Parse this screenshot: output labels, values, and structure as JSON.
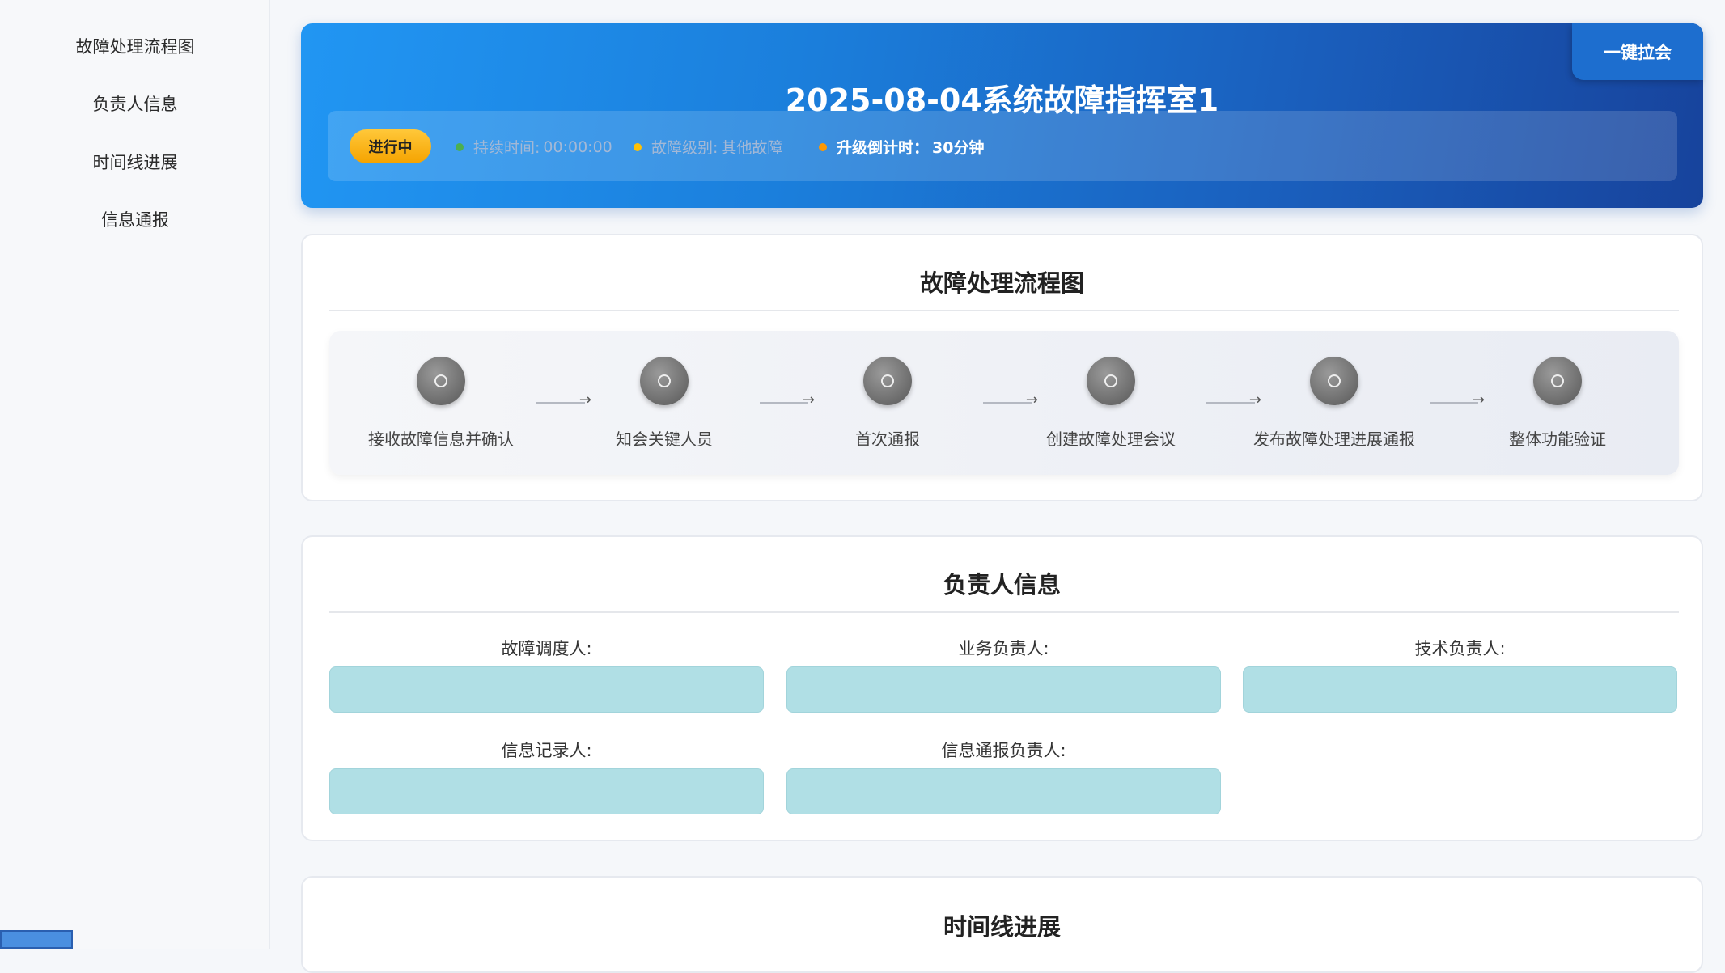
{
  "sidebar": {
    "items": [
      {
        "label": "故障处理流程图"
      },
      {
        "label": "负责人信息"
      },
      {
        "label": "时间线进展"
      },
      {
        "label": "信息通报"
      }
    ]
  },
  "banner": {
    "title": "2025-08-04系统故障指挥室1",
    "rally_button": "一键拉会",
    "status_badge": "进行中",
    "duration_label": "持续时间:",
    "duration_value": "00:00:00",
    "level_label": "故障级别:",
    "level_value": "其他故障",
    "countdown_label": "升级倒计时：",
    "countdown_value": "30分钟",
    "colors": {
      "duration_dot": "#4caf50",
      "level_dot": "#ffc107",
      "countdown_dot": "#ff9800"
    }
  },
  "flow": {
    "title": "故障处理流程图",
    "steps": [
      {
        "label": "接收故障信息并确认"
      },
      {
        "label": "知会关键人员"
      },
      {
        "label": "首次通报"
      },
      {
        "label": "创建故障处理会议"
      },
      {
        "label": "发布故障处理进展通报"
      },
      {
        "label": "整体功能验证"
      }
    ]
  },
  "owners": {
    "title": "负责人信息",
    "fields": [
      {
        "label": "故障调度人:",
        "value": ""
      },
      {
        "label": "业务负责人:",
        "value": ""
      },
      {
        "label": "技术负责人:",
        "value": ""
      },
      {
        "label": "信息记录人:",
        "value": ""
      },
      {
        "label": "信息通报负责人:",
        "value": ""
      }
    ]
  },
  "timeline": {
    "title": "时间线进展"
  }
}
